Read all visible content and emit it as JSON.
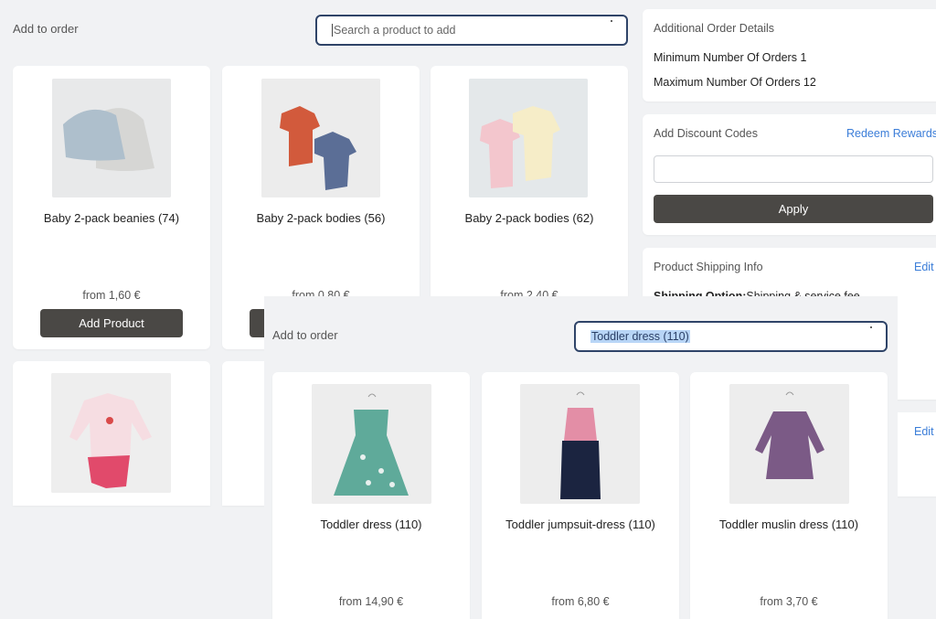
{
  "back": {
    "title": "Add to order",
    "search_placeholder": "Search a product to add",
    "products": [
      {
        "name": "Baby 2-pack beanies (74)",
        "price": "from 1,60 €",
        "button": "Add Product"
      },
      {
        "name": "Baby 2-pack bodies (56)",
        "price": "from 0,80 €"
      },
      {
        "name": "Baby 2-pack bodies (62)",
        "price": "from 2,40 €"
      }
    ]
  },
  "sidebar": {
    "order_details": {
      "title": "Additional Order Details",
      "min_orders": "Minimum Number Of Orders 1",
      "max_orders": "Maximum Number Of Orders 12"
    },
    "discount": {
      "title": "Add Discount Codes",
      "redeem_link": "Redeem Rewards",
      "input_value": "",
      "apply_label": "Apply"
    },
    "shipping": {
      "title": "Product Shipping Info",
      "edit_label": "Edit",
      "option_label": "Shipping Option:",
      "option_value": "Shipping & service fee"
    },
    "second_edit_label": "Edit"
  },
  "front": {
    "title": "Add to order",
    "search_value": "Toddler dress (110)",
    "products": [
      {
        "name": "Toddler dress (110)",
        "price": "from 14,90 €"
      },
      {
        "name": "Toddler jumpsuit-dress (110)",
        "price": "from 6,80 €"
      },
      {
        "name": "Toddler muslin dress (110)",
        "price": "from 3,70 €"
      }
    ]
  },
  "colors": {
    "background": "#f1f2f4",
    "accent_link": "#3b7dd8",
    "dark_button": "#4a4845",
    "search_border": "#2f4468"
  }
}
